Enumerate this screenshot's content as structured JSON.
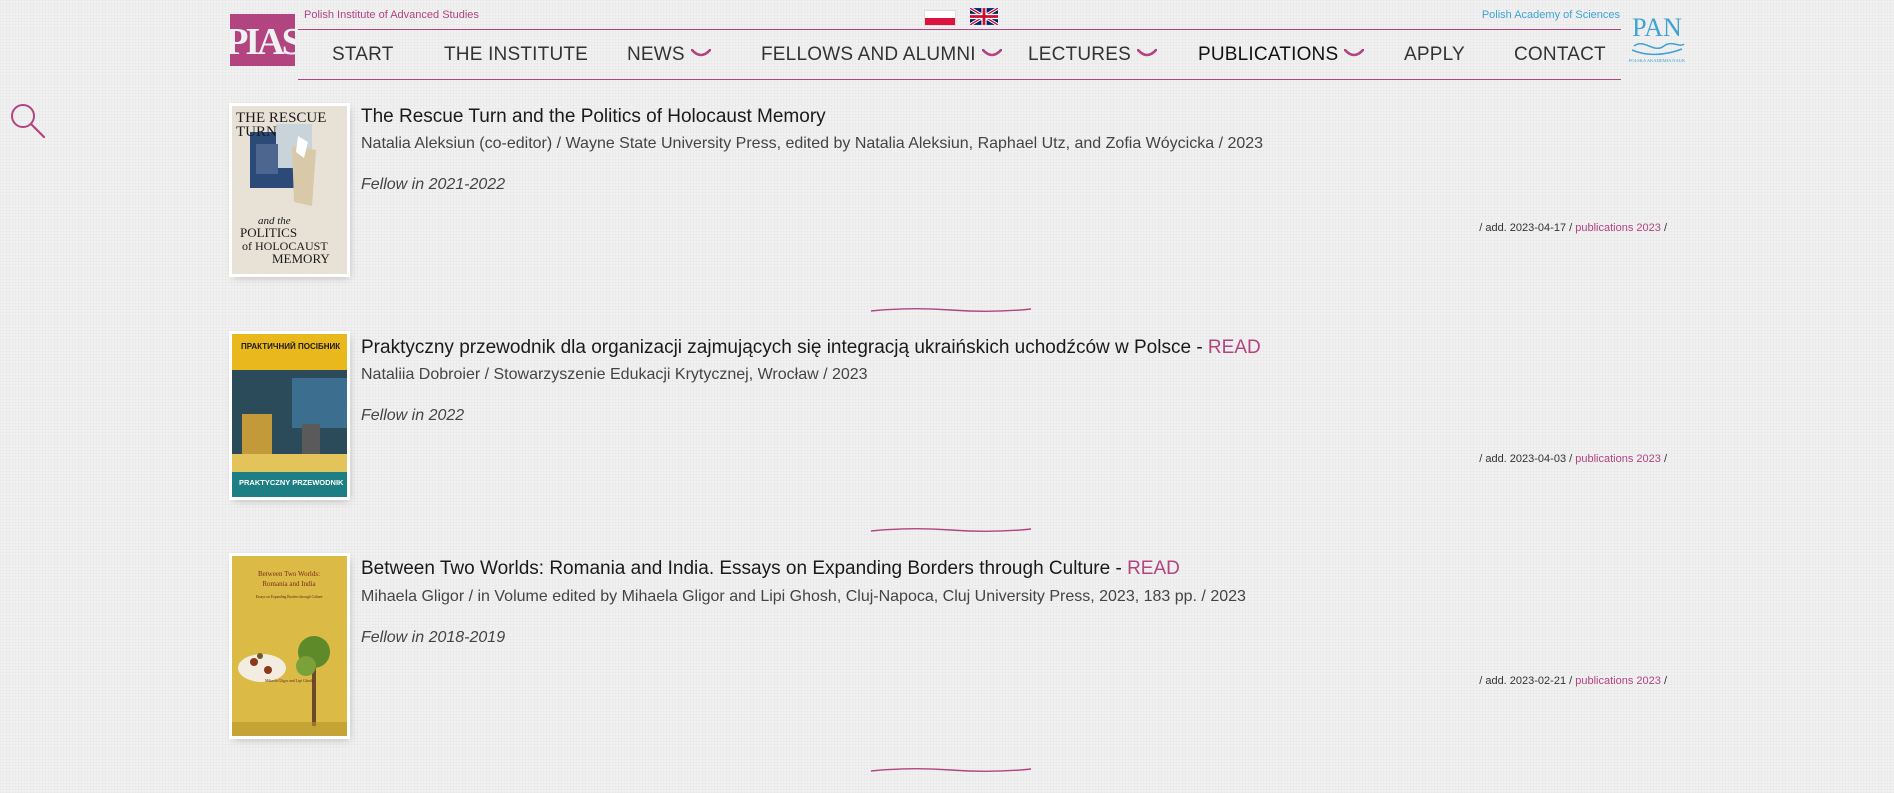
{
  "header": {
    "institute_name": "Polish Institute of Advanced Studies",
    "logo_text": "PIAS",
    "academy_name": "Polish Academy of Sciences",
    "academy_logo_text": "PAN",
    "academy_logo_subtext": "POLSKA AKADEMIA NAUK"
  },
  "nav": {
    "items": [
      {
        "label": "START"
      },
      {
        "label": "THE INSTITUTE"
      },
      {
        "label": "NEWS"
      },
      {
        "label": "FELLOWS AND ALUMNI"
      },
      {
        "label": "LECTURES"
      },
      {
        "label": "PUBLICATIONS"
      },
      {
        "label": "APPLY"
      },
      {
        "label": "CONTACT"
      }
    ]
  },
  "colors": {
    "accent": "#b2447f",
    "academy_blue": "#3ea3d2",
    "background": "#f1f1f2"
  },
  "entries": [
    {
      "title": "The Rescue Turn and the Politics of Holocaust Memory",
      "read": "",
      "meta": "Natalia Aleksiun (co-editor) / Wayne State University Press, edited by Natalia Aleksiun, Raphael Utz, and Zofia Wóycicka / 2023",
      "fellow": "Fellow in 2021-2022",
      "added_prefix": "/ add. 2023-04-17 /",
      "category": "publications 2023",
      "added_suffix": "/",
      "cover": {
        "line1": "THE RESCUE",
        "line2": "TURN",
        "line3": "and the",
        "line4": "POLITICS",
        "line5": "of HOLOCAUST",
        "line6": "MEMORY"
      }
    },
    {
      "title": "Praktyczny przewodnik dla organizacji zajmujących się integracją ukraińskich uchodźców w Polsce - ",
      "read": "READ",
      "meta": "Nataliia Dobroier / Stowarzyszenie Edukacji Krytycznej, Wrocław / 2023",
      "fellow": "Fellow in 2022",
      "added_prefix": "/ add. 2023-04-03 /",
      "category": "publications 2023",
      "added_suffix": "/",
      "cover": {
        "line1": "ПРАКТИЧНИЙ ПОСІБНИК",
        "line2": "PRAKTYCZNY PRZEWODNIK"
      }
    },
    {
      "title": "Between Two Worlds: Romania and India. Essays on Expanding Borders through Culture - ",
      "read": "READ",
      "meta": "Mihaela Gligor / in Volume edited by Mihaela Gligor and Lipi Ghosh, Cluj-Napoca, Cluj University Press, 2023, 183 pp. / 2023",
      "fellow": "Fellow in 2018-2019",
      "added_prefix": "/ add. 2023-02-21 /",
      "category": "publications 2023",
      "added_suffix": "/",
      "cover": {
        "line1": "Between Two Worlds:",
        "line2": "Romania and India",
        "line3": "Essays on Expanding Borders through Culture",
        "line4": "Mihaela Gligor and Lipi Ghosh"
      }
    }
  ]
}
